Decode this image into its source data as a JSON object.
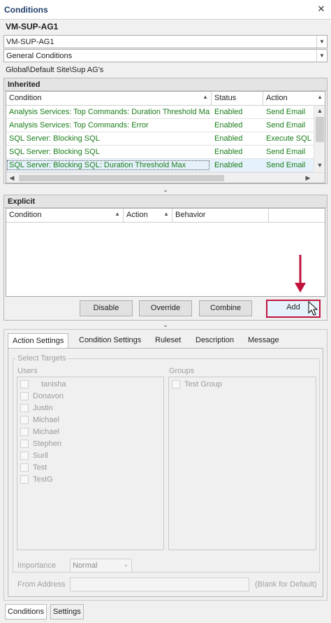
{
  "window": {
    "title": "Conditions",
    "close_glyph": "✕"
  },
  "host": {
    "name": "VM-SUP-AG1"
  },
  "combos": {
    "server": "VM-SUP-AG1",
    "category": "General Conditions"
  },
  "path": "Global\\Default Site\\Sup AG's",
  "inherited": {
    "title": "Inherited",
    "columns": [
      "Condition",
      "Status",
      "Action"
    ],
    "rows": [
      [
        "Analysis Services: Top Commands: Duration Threshold Max",
        "Enabled",
        "Send Email"
      ],
      [
        "Analysis Services: Top Commands: Error",
        "Enabled",
        "Send Email"
      ],
      [
        "SQL Server: Blocking SQL",
        "Enabled",
        "Execute SQL"
      ],
      [
        "SQL Server: Blocking SQL",
        "Enabled",
        "Send Email"
      ],
      [
        "SQL Server: Blocking SQL: Duration Threshold Max",
        "Enabled",
        "Send Email"
      ]
    ]
  },
  "explicit": {
    "title": "Explicit",
    "columns": [
      "Condition",
      "Action",
      "Behavior"
    ],
    "buttons": {
      "disable": "Disable",
      "override": "Override",
      "combine": "Combine",
      "add": "Add"
    }
  },
  "tabs": [
    "Action Settings",
    "Condition Settings",
    "Ruleset",
    "Description",
    "Message"
  ],
  "targets": {
    "legend": "Select Targets",
    "users_label": "Users",
    "groups_label": "Groups",
    "users": [
      "tanisha",
      "Donavon",
      "Justin",
      "Michael",
      "Michael",
      "Stephen",
      "Suril",
      "Test",
      "TestG"
    ],
    "groups": [
      "Test Group"
    ]
  },
  "importance": {
    "label": "Importance",
    "value": "Normal"
  },
  "from_address": {
    "label": "From Address",
    "hint": "(Blank for Default)",
    "value": ""
  },
  "bottom_tabs": [
    "Conditions",
    "Settings"
  ],
  "colors": {
    "accent": "#c0143c",
    "enabled_text": "#1a7d1a",
    "title": "#1f3f6b"
  }
}
